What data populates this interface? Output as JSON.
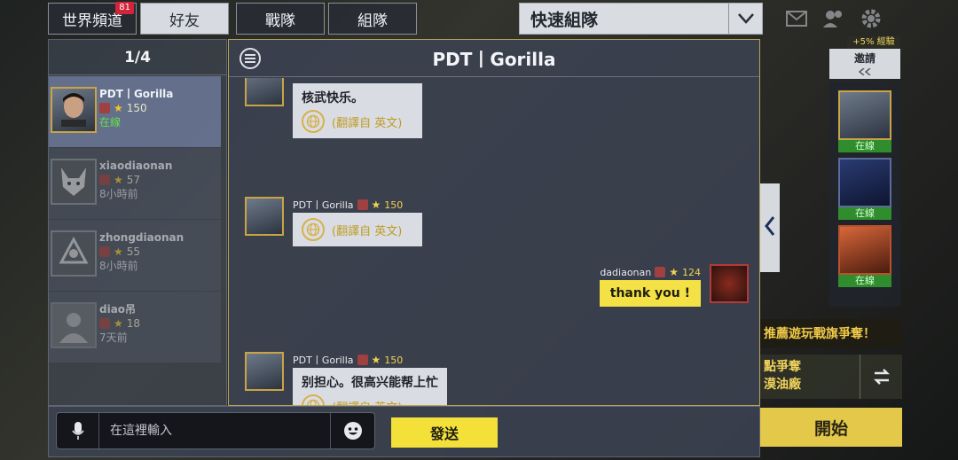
{
  "tabs": {
    "world": "世界頻道",
    "world_badge": "81",
    "friends": "好友",
    "clan": "戰隊",
    "team": "組隊"
  },
  "quick_team": {
    "label": "快速組隊"
  },
  "friends_list": {
    "page_indicator": "1/4",
    "items": [
      {
        "name": "PDT丨Gorilla",
        "level": "150",
        "status": "在線"
      },
      {
        "name": "xiaodiaonan",
        "level": "57",
        "status": "8小時前"
      },
      {
        "name": "zhongdiaonan",
        "level": "55",
        "status": "8小時前"
      },
      {
        "name": "diao吊",
        "level": "18",
        "status": "7天前"
      }
    ]
  },
  "chat": {
    "title": "PDT丨Gorilla",
    "messages": [
      {
        "sender": "",
        "level": "",
        "text": "核武快乐。",
        "translation": "(翻譯自 英文)"
      },
      {
        "sender": "PDT丨Gorilla",
        "level": "150",
        "text": "",
        "translation": "(翻譯自 英文)"
      },
      {
        "sender": "dadiaonan",
        "level": "124",
        "text": "thank you !",
        "translation": ""
      },
      {
        "sender": "PDT丨Gorilla",
        "level": "150",
        "text": "别担心。很高兴能帮上忙",
        "translation": "(翻譯自 英文)"
      }
    ]
  },
  "input": {
    "placeholder": "在這裡輸入",
    "send_label": "發送"
  },
  "side": {
    "bonus": "+5% 經驗",
    "invite": "邀請",
    "friends": [
      {
        "status": "在線"
      },
      {
        "status": "在線"
      },
      {
        "status": "在線"
      }
    ],
    "event_banner": "推薦遊玩戰旗爭奪！",
    "mode_line1": "點爭奪",
    "mode_line2": "漠油廠",
    "start": "開始"
  }
}
